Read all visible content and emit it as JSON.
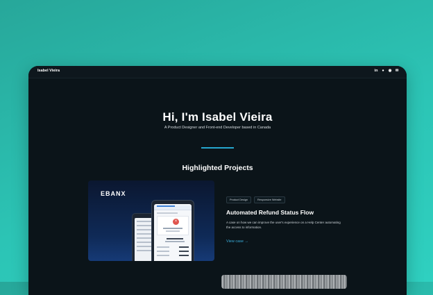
{
  "window": {
    "brand": "Isabel Vieira",
    "social": [
      {
        "name": "linkedin-icon",
        "glyph": "in"
      },
      {
        "name": "chat-icon",
        "glyph": "●"
      },
      {
        "name": "github-icon",
        "glyph": "◉"
      },
      {
        "name": "mail-icon",
        "glyph": "✉"
      }
    ]
  },
  "hero": {
    "title": "Hi, I'm Isabel Vieira",
    "subtitle": "A Product Designer and Front-end Developer based in Canada"
  },
  "projects_section": {
    "title": "Highlighted Projects",
    "items": [
      {
        "logo": "EBANX",
        "tags": [
          "Product Design",
          "Responsive Website"
        ],
        "title": "Automated Refund Status Flow",
        "description": "A case on how we can improve the user's experience on a Help Center automating the access to information.",
        "link": "View case →"
      }
    ]
  },
  "colors": {
    "background": "#2cc4b5",
    "window": "#0b1419",
    "accent": "#26a7cf"
  }
}
